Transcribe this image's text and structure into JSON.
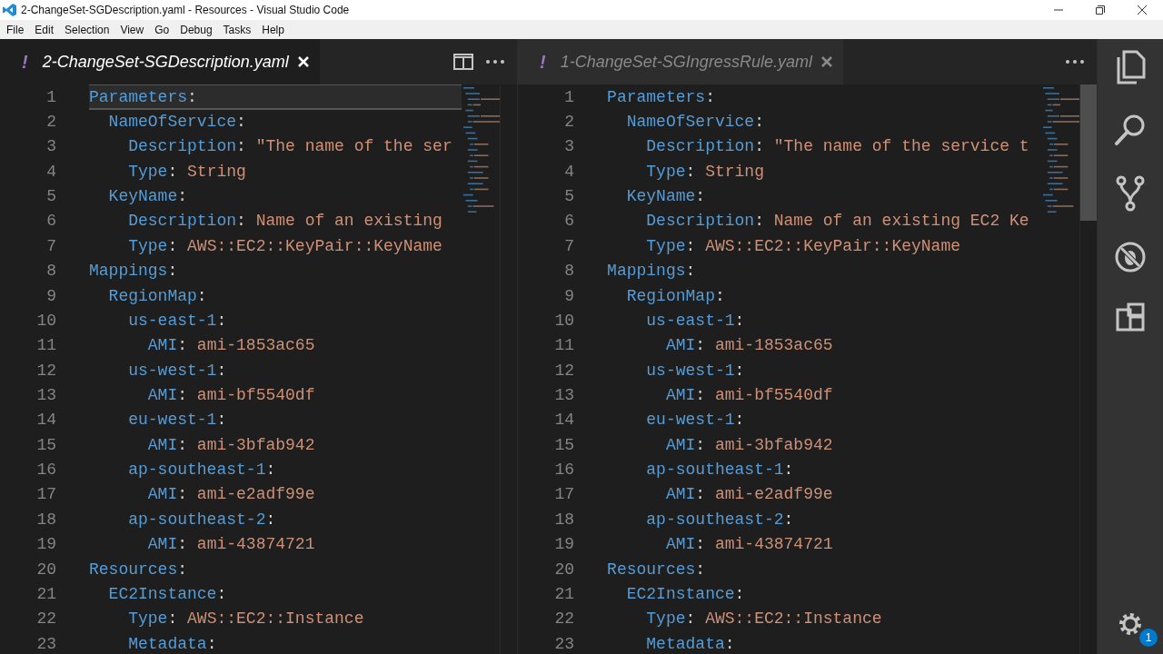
{
  "window": {
    "title": "2-ChangeSet-SGDescription.yaml - Resources - Visual Studio Code"
  },
  "menu": [
    "File",
    "Edit",
    "Selection",
    "View",
    "Go",
    "Debug",
    "Tasks",
    "Help"
  ],
  "editors": [
    {
      "tab": {
        "marker": "!",
        "label": "2-ChangeSet-SGDescription.yaml",
        "selected": true
      },
      "actions": [
        {
          "kind": "split"
        },
        {
          "kind": "more"
        }
      ],
      "lines": [
        {
          "number": "1",
          "key": "Parameters",
          "colon": ":",
          "current": true
        },
        {
          "number": "2",
          "key": "  NameOfService",
          "colon": ":",
          "current": false
        },
        {
          "number": "3",
          "key": "    Description",
          "colon": ":",
          "value": " \"The name of the ser",
          "current": false
        },
        {
          "number": "4",
          "key": "    Type",
          "colon": ":",
          "value": " String",
          "current": false
        },
        {
          "number": "5",
          "key": "  KeyName",
          "colon": ":",
          "current": false
        },
        {
          "number": "6",
          "key": "    Description",
          "colon": ":",
          "value": " Name of an existing",
          "current": false
        },
        {
          "number": "7",
          "key": "    Type",
          "colon": ":",
          "value": " AWS::EC2::KeyPair::KeyName",
          "current": false
        },
        {
          "number": "8",
          "key": "Mappings",
          "colon": ":",
          "current": false
        },
        {
          "number": "9",
          "key": "  RegionMap",
          "colon": ":",
          "current": false
        },
        {
          "number": "10",
          "key": "    us-east-1",
          "colon": ":",
          "current": false
        },
        {
          "number": "11",
          "key": "      AMI",
          "colon": ":",
          "value": " ami-1853ac65",
          "current": false
        },
        {
          "number": "12",
          "key": "    us-west-1",
          "colon": ":",
          "current": false
        },
        {
          "number": "13",
          "key": "      AMI",
          "colon": ":",
          "value": " ami-bf5540df",
          "current": false
        },
        {
          "number": "14",
          "key": "    eu-west-1",
          "colon": ":",
          "current": false
        },
        {
          "number": "15",
          "key": "      AMI",
          "colon": ":",
          "value": " ami-3bfab942",
          "current": false
        },
        {
          "number": "16",
          "key": "    ap-southeast-1",
          "colon": ":",
          "current": false
        },
        {
          "number": "17",
          "key": "      AMI",
          "colon": ":",
          "value": " ami-e2adf99e",
          "current": false
        },
        {
          "number": "18",
          "key": "    ap-southeast-2",
          "colon": ":",
          "current": false
        },
        {
          "number": "19",
          "key": "      AMI",
          "colon": ":",
          "value": " ami-43874721",
          "current": false
        },
        {
          "number": "20",
          "key": "Resources",
          "colon": ":",
          "current": false
        },
        {
          "number": "21",
          "key": "  EC2Instance",
          "colon": ":",
          "current": false
        },
        {
          "number": "22",
          "key": "    Type",
          "colon": ":",
          "value": " AWS::EC2::Instance",
          "current": false
        },
        {
          "number": "23",
          "key": "    Metadata",
          "colon": ":",
          "current": false
        }
      ]
    },
    {
      "tab": {
        "marker": "!",
        "label": "1-ChangeSet-SGIngressRule.yaml",
        "selected": false
      },
      "actions": [
        {
          "kind": "more"
        }
      ],
      "lines": [
        {
          "number": "1",
          "key": "Parameters",
          "colon": ":",
          "current": false
        },
        {
          "number": "2",
          "key": "  NameOfService",
          "colon": ":",
          "current": false
        },
        {
          "number": "3",
          "key": "    Description",
          "colon": ":",
          "value": " \"The name of the service t",
          "current": false
        },
        {
          "number": "4",
          "key": "    Type",
          "colon": ":",
          "value": " String",
          "current": false
        },
        {
          "number": "5",
          "key": "  KeyName",
          "colon": ":",
          "current": false
        },
        {
          "number": "6",
          "key": "    Description",
          "colon": ":",
          "value": " Name of an existing EC2 Ke",
          "current": false
        },
        {
          "number": "7",
          "key": "    Type",
          "colon": ":",
          "value": " AWS::EC2::KeyPair::KeyName",
          "current": false
        },
        {
          "number": "8",
          "key": "Mappings",
          "colon": ":",
          "current": false
        },
        {
          "number": "9",
          "key": "  RegionMap",
          "colon": ":",
          "current": false
        },
        {
          "number": "10",
          "key": "    us-east-1",
          "colon": ":",
          "current": false
        },
        {
          "number": "11",
          "key": "      AMI",
          "colon": ":",
          "value": " ami-1853ac65",
          "current": false
        },
        {
          "number": "12",
          "key": "    us-west-1",
          "colon": ":",
          "current": false
        },
        {
          "number": "13",
          "key": "      AMI",
          "colon": ":",
          "value": " ami-bf5540df",
          "current": false
        },
        {
          "number": "14",
          "key": "    eu-west-1",
          "colon": ":",
          "current": false
        },
        {
          "number": "15",
          "key": "      AMI",
          "colon": ":",
          "value": " ami-3bfab942",
          "current": false
        },
        {
          "number": "16",
          "key": "    ap-southeast-1",
          "colon": ":",
          "current": false
        },
        {
          "number": "17",
          "key": "      AMI",
          "colon": ":",
          "value": " ami-e2adf99e",
          "current": false
        },
        {
          "number": "18",
          "key": "    ap-southeast-2",
          "colon": ":",
          "current": false
        },
        {
          "number": "19",
          "key": "      AMI",
          "colon": ":",
          "value": " ami-43874721",
          "current": false
        },
        {
          "number": "20",
          "key": "Resources",
          "colon": ":",
          "current": false
        },
        {
          "number": "21",
          "key": "  EC2Instance",
          "colon": ":",
          "current": false
        },
        {
          "number": "22",
          "key": "    Type",
          "colon": ":",
          "value": " AWS::EC2::Instance",
          "current": false
        },
        {
          "number": "23",
          "key": "    Metadata",
          "colon": ":",
          "current": false
        }
      ]
    }
  ],
  "settings_badge": "1"
}
